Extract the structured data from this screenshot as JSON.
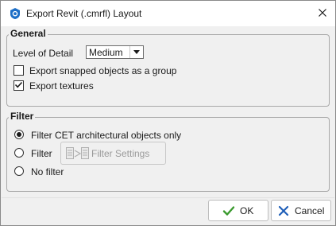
{
  "window": {
    "title": "Export Revit (.cmrfl) Layout",
    "accent_color": "#1e6fc7"
  },
  "icons": {
    "app": "revit-shield-icon",
    "close": "close-icon",
    "dropdown": "chevron-down-icon",
    "check": "checkmark-icon",
    "filter_settings": "filter-settings-icon",
    "ok": "green-checkmark-icon",
    "cancel": "blue-x-icon"
  },
  "general": {
    "title": "General",
    "level_of_detail": {
      "label": "Level of Detail",
      "value": "Medium"
    },
    "export_snapped": {
      "label": "Export snapped objects as a group",
      "checked": false
    },
    "export_textures": {
      "label": "Export textures",
      "checked": true
    }
  },
  "filter": {
    "title": "Filter",
    "options": [
      {
        "label": "Filter CET architectural objects only",
        "selected": true
      },
      {
        "label": "Filter",
        "selected": false
      },
      {
        "label": "No filter",
        "selected": false
      }
    ],
    "settings_button": {
      "label": "Filter Settings",
      "enabled": false
    }
  },
  "buttons": {
    "ok": "OK",
    "cancel": "Cancel"
  }
}
